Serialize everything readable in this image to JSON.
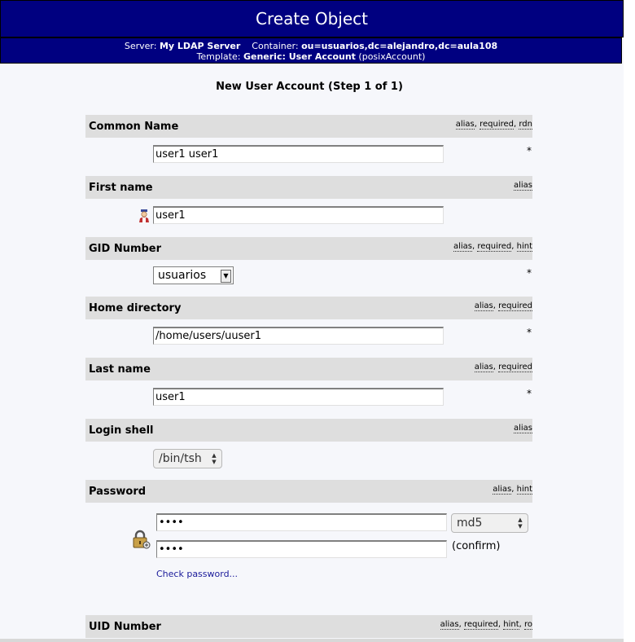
{
  "header": {
    "title": "Create Object",
    "server_label": "Server:",
    "server_value": "My LDAP Server",
    "container_label": "Container:",
    "container_value": "ou=usuarios,dc=alejandro,dc=aula108",
    "template_label": "Template:",
    "template_value": "Generic: User Account",
    "template_class": "(posixAccount)"
  },
  "form": {
    "step_title": "New User Account (Step 1 of 1)",
    "attributes": [
      {
        "name": "Common Name",
        "flags": [
          "alias",
          "required",
          "rdn"
        ],
        "value": "user1 user1",
        "required": true
      },
      {
        "name": "First name",
        "flags": [
          "alias"
        ],
        "value": "user1",
        "icon": "user-icon"
      },
      {
        "name": "GID Number",
        "flags": [
          "alias",
          "required",
          "hint"
        ],
        "value": "usuarios",
        "required": true
      },
      {
        "name": "Home directory",
        "flags": [
          "alias",
          "required"
        ],
        "value": "/home/users/uuser1",
        "required": true
      },
      {
        "name": "Last name",
        "flags": [
          "alias",
          "required"
        ],
        "value": "user1",
        "required": true
      },
      {
        "name": "Login shell",
        "flags": [
          "alias"
        ],
        "value": "/bin/tsh"
      },
      {
        "name": "Password",
        "flags": [
          "alias",
          "hint"
        ],
        "value": "••••",
        "confirm_value": "••••",
        "hash": "md5",
        "confirm_label": "(confirm)",
        "check_link": "Check password...",
        "icon": "lock-icon"
      },
      {
        "name": "UID Number",
        "flags": [
          "alias",
          "required",
          "hint",
          "ro"
        ]
      }
    ],
    "required_marker": "*"
  }
}
